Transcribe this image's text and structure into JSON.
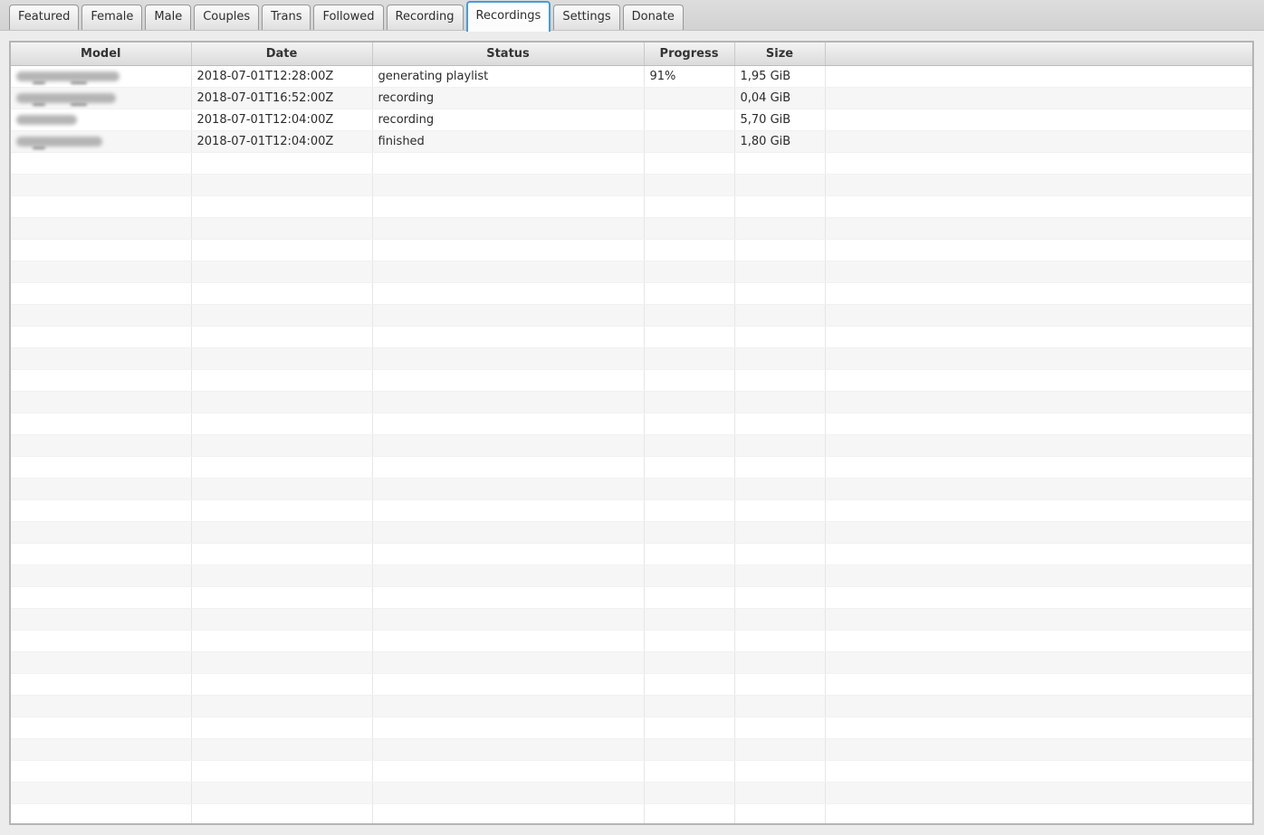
{
  "colors": {
    "active_tab_border": "#459ed7",
    "row_stripe": "#f6f6f6",
    "panel_border": "#b5b5b5",
    "header_text": "#333333",
    "cell_text": "#2b2b2b"
  },
  "tabs": [
    {
      "label": "Featured",
      "active": false
    },
    {
      "label": "Female",
      "active": false
    },
    {
      "label": "Male",
      "active": false
    },
    {
      "label": "Couples",
      "active": false
    },
    {
      "label": "Trans",
      "active": false
    },
    {
      "label": "Followed",
      "active": false
    },
    {
      "label": "Recording",
      "active": false
    },
    {
      "label": "Recordings",
      "active": true
    },
    {
      "label": "Settings",
      "active": false
    },
    {
      "label": "Donate",
      "active": false
    }
  ],
  "table": {
    "columns": [
      {
        "key": "model",
        "label": "Model"
      },
      {
        "key": "date",
        "label": "Date"
      },
      {
        "key": "status",
        "label": "Status"
      },
      {
        "key": "progress",
        "label": "Progress"
      },
      {
        "key": "size",
        "label": "Size"
      },
      {
        "key": "extra",
        "label": ""
      }
    ],
    "rows": [
      {
        "model_redacted": true,
        "model_blur_width": 114,
        "model_smudges": 2,
        "date": "2018-07-01T12:28:00Z",
        "status": "generating playlist",
        "progress": "91%",
        "size": "1,95 GiB"
      },
      {
        "model_redacted": true,
        "model_blur_width": 110,
        "model_smudges": 2,
        "date": "2018-07-01T16:52:00Z",
        "status": "recording",
        "progress": "",
        "size": "0,04 GiB"
      },
      {
        "model_redacted": true,
        "model_blur_width": 67,
        "model_smudges": 0,
        "date": "2018-07-01T12:04:00Z",
        "status": "recording",
        "progress": "",
        "size": "5,70 GiB"
      },
      {
        "model_redacted": true,
        "model_blur_width": 95,
        "model_smudges": 1,
        "date": "2018-07-01T12:04:00Z",
        "status": "finished",
        "progress": "",
        "size": "1,80 GiB"
      }
    ],
    "empty_row_count": 31
  }
}
